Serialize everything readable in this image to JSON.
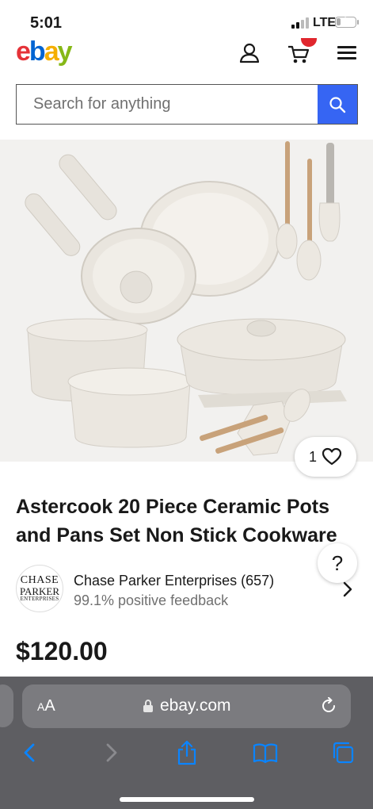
{
  "status_bar": {
    "time": "5:01",
    "network": "LTE",
    "battery": "1"
  },
  "header": {
    "logo_letters": [
      "e",
      "b",
      "a",
      "y"
    ],
    "cart_badge": ""
  },
  "search": {
    "placeholder": "Search for anything"
  },
  "product": {
    "watch_count": "1",
    "title": "Astercook 20 Piece Ceramic Pots and Pans Set Non Stick Cookware",
    "price": "$120.00"
  },
  "help": {
    "label": "?"
  },
  "seller": {
    "avatar_text": [
      "CHASE",
      "PARKER",
      "ENTERPRISES"
    ],
    "name": "Chase Parker Enterprises (657)",
    "feedback": "99.1% positive feedback"
  },
  "browser": {
    "aa_small": "A",
    "aa_large": "A",
    "url": "ebay.com"
  },
  "colors": {
    "ebay_red": "#e53238",
    "ebay_blue": "#0064d2",
    "ebay_yellow": "#f5af02",
    "ebay_green": "#86b817",
    "search_button": "#3665f3",
    "safari_toolbar": "#5e5e62",
    "safari_accent": "#0a84ff"
  },
  "icons": [
    "user-icon",
    "cart-icon",
    "menu-icon",
    "search-icon",
    "heart-icon",
    "chevron-right-icon",
    "lock-icon",
    "reload-icon",
    "back-icon",
    "forward-icon",
    "share-icon",
    "bookmarks-icon",
    "tabs-icon"
  ]
}
